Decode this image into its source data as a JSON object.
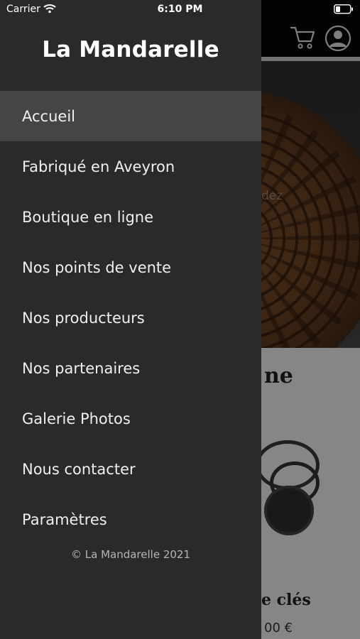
{
  "status_bar": {
    "carrier": "Carrier",
    "time": "6:10 PM"
  },
  "drawer": {
    "title": "La Mandarelle",
    "items": [
      {
        "label": "Accueil",
        "active": true
      },
      {
        "label": "Fabriqué en Aveyron"
      },
      {
        "label": "Boutique en ligne"
      },
      {
        "label": "Nos points de vente"
      },
      {
        "label": "Nos producteurs"
      },
      {
        "label": "Nos partenaires"
      },
      {
        "label": "Galerie Photos"
      },
      {
        "label": "Nous contacter"
      },
      {
        "label": "Paramètres"
      }
    ],
    "copyright": "© La Mandarelle 2021"
  },
  "background_page": {
    "hero_overlay_partial": "dez",
    "section_title_partial": "ne",
    "card_title_partial": "e clés",
    "price_partial": "00 €",
    "icons": [
      "cart-icon",
      "user-icon"
    ]
  }
}
